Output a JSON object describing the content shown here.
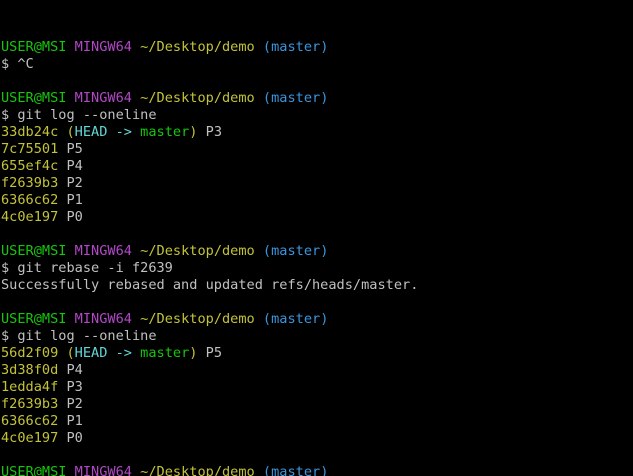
{
  "window": {
    "colors": {
      "background": "#000000",
      "text": "#c0c0c0",
      "user_host": "#16c60c",
      "msystem": "#b148c6",
      "path": "#c3c339",
      "branch_paren": "#3a96dd",
      "hash": "#c3c339",
      "head": "#61d6d6",
      "head_branch": "#16c60c"
    }
  },
  "lines": [
    {
      "name": "prompt-line",
      "segments": [
        {
          "text": "USER@MSI",
          "color": "#16c60c"
        },
        {
          "text": " ",
          "color": "#c0c0c0"
        },
        {
          "text": "MINGW64",
          "color": "#b148c6"
        },
        {
          "text": " ",
          "color": "#c0c0c0"
        },
        {
          "text": "~/Desktop/demo",
          "color": "#c3c339"
        },
        {
          "text": " ",
          "color": "#c0c0c0"
        },
        {
          "text": "(master)",
          "color": "#3a96dd"
        }
      ]
    },
    {
      "name": "command-line",
      "segments": [
        {
          "text": "$ ^C",
          "color": "#c0c0c0"
        }
      ]
    },
    {
      "name": "blank-line",
      "segments": []
    },
    {
      "name": "prompt-line",
      "segments": [
        {
          "text": "USER@MSI",
          "color": "#16c60c"
        },
        {
          "text": " ",
          "color": "#c0c0c0"
        },
        {
          "text": "MINGW64",
          "color": "#b148c6"
        },
        {
          "text": " ",
          "color": "#c0c0c0"
        },
        {
          "text": "~/Desktop/demo",
          "color": "#c3c339"
        },
        {
          "text": " ",
          "color": "#c0c0c0"
        },
        {
          "text": "(master)",
          "color": "#3a96dd"
        }
      ]
    },
    {
      "name": "command-line",
      "segments": [
        {
          "text": "$ git log --oneline",
          "color": "#c0c0c0"
        }
      ]
    },
    {
      "name": "log-entry",
      "segments": [
        {
          "text": "33db24c",
          "color": "#c3c339"
        },
        {
          "text": " ",
          "color": "#c0c0c0"
        },
        {
          "text": "(",
          "color": "#c3c339"
        },
        {
          "text": "HEAD -> ",
          "color": "#61d6d6"
        },
        {
          "text": "master",
          "color": "#16c60c"
        },
        {
          "text": ")",
          "color": "#c3c339"
        },
        {
          "text": " P3",
          "color": "#c0c0c0"
        }
      ]
    },
    {
      "name": "log-entry",
      "segments": [
        {
          "text": "7c75501",
          "color": "#c3c339"
        },
        {
          "text": " P5",
          "color": "#c0c0c0"
        }
      ]
    },
    {
      "name": "log-entry",
      "segments": [
        {
          "text": "655ef4c",
          "color": "#c3c339"
        },
        {
          "text": " P4",
          "color": "#c0c0c0"
        }
      ]
    },
    {
      "name": "log-entry",
      "segments": [
        {
          "text": "f2639b3",
          "color": "#c3c339"
        },
        {
          "text": " P2",
          "color": "#c0c0c0"
        }
      ]
    },
    {
      "name": "log-entry",
      "segments": [
        {
          "text": "6366c62",
          "color": "#c3c339"
        },
        {
          "text": " P1",
          "color": "#c0c0c0"
        }
      ]
    },
    {
      "name": "log-entry",
      "segments": [
        {
          "text": "4c0e197",
          "color": "#c3c339"
        },
        {
          "text": " P0",
          "color": "#c0c0c0"
        }
      ]
    },
    {
      "name": "blank-line",
      "segments": []
    },
    {
      "name": "prompt-line",
      "segments": [
        {
          "text": "USER@MSI",
          "color": "#16c60c"
        },
        {
          "text": " ",
          "color": "#c0c0c0"
        },
        {
          "text": "MINGW64",
          "color": "#b148c6"
        },
        {
          "text": " ",
          "color": "#c0c0c0"
        },
        {
          "text": "~/Desktop/demo",
          "color": "#c3c339"
        },
        {
          "text": " ",
          "color": "#c0c0c0"
        },
        {
          "text": "(master)",
          "color": "#3a96dd"
        }
      ]
    },
    {
      "name": "command-line",
      "segments": [
        {
          "text": "$ git rebase -i f2639",
          "color": "#c0c0c0"
        }
      ]
    },
    {
      "name": "output-line",
      "segments": [
        {
          "text": "Successfully rebased and updated refs/heads/master.",
          "color": "#c0c0c0"
        }
      ]
    },
    {
      "name": "blank-line",
      "segments": []
    },
    {
      "name": "prompt-line",
      "segments": [
        {
          "text": "USER@MSI",
          "color": "#16c60c"
        },
        {
          "text": " ",
          "color": "#c0c0c0"
        },
        {
          "text": "MINGW64",
          "color": "#b148c6"
        },
        {
          "text": " ",
          "color": "#c0c0c0"
        },
        {
          "text": "~/Desktop/demo",
          "color": "#c3c339"
        },
        {
          "text": " ",
          "color": "#c0c0c0"
        },
        {
          "text": "(master)",
          "color": "#3a96dd"
        }
      ]
    },
    {
      "name": "command-line",
      "segments": [
        {
          "text": "$ git log --oneline",
          "color": "#c0c0c0"
        }
      ]
    },
    {
      "name": "log-entry",
      "segments": [
        {
          "text": "56d2f09",
          "color": "#c3c339"
        },
        {
          "text": " ",
          "color": "#c0c0c0"
        },
        {
          "text": "(",
          "color": "#c3c339"
        },
        {
          "text": "HEAD -> ",
          "color": "#61d6d6"
        },
        {
          "text": "master",
          "color": "#16c60c"
        },
        {
          "text": ")",
          "color": "#c3c339"
        },
        {
          "text": " P5",
          "color": "#c0c0c0"
        }
      ]
    },
    {
      "name": "log-entry",
      "segments": [
        {
          "text": "3d38f0d",
          "color": "#c3c339"
        },
        {
          "text": " P4",
          "color": "#c0c0c0"
        }
      ]
    },
    {
      "name": "log-entry",
      "segments": [
        {
          "text": "1edda4f",
          "color": "#c3c339"
        },
        {
          "text": " P3",
          "color": "#c0c0c0"
        }
      ]
    },
    {
      "name": "log-entry",
      "segments": [
        {
          "text": "f2639b3",
          "color": "#c3c339"
        },
        {
          "text": " P2",
          "color": "#c0c0c0"
        }
      ]
    },
    {
      "name": "log-entry",
      "segments": [
        {
          "text": "6366c62",
          "color": "#c3c339"
        },
        {
          "text": " P1",
          "color": "#c0c0c0"
        }
      ]
    },
    {
      "name": "log-entry",
      "segments": [
        {
          "text": "4c0e197",
          "color": "#c3c339"
        },
        {
          "text": " P0",
          "color": "#c0c0c0"
        }
      ]
    },
    {
      "name": "blank-line",
      "segments": []
    },
    {
      "name": "prompt-line",
      "segments": [
        {
          "text": "USER@MSI",
          "color": "#16c60c"
        },
        {
          "text": " ",
          "color": "#c0c0c0"
        },
        {
          "text": "MINGW64",
          "color": "#b148c6"
        },
        {
          "text": " ",
          "color": "#c0c0c0"
        },
        {
          "text": "~/Desktop/demo",
          "color": "#c3c339"
        },
        {
          "text": " ",
          "color": "#c0c0c0"
        },
        {
          "text": "(master)",
          "color": "#3a96dd"
        }
      ]
    },
    {
      "name": "input-line",
      "cursor": true,
      "segments": [
        {
          "text": "$ ",
          "color": "#c0c0c0"
        }
      ]
    }
  ]
}
